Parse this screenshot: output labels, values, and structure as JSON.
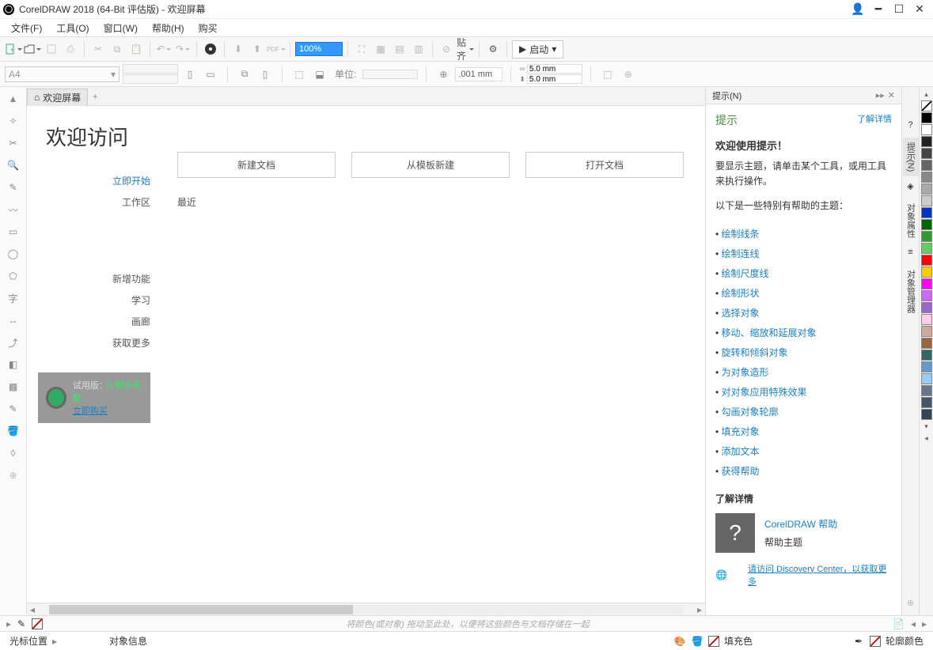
{
  "title": "CorelDRAW 2018 (64-Bit 评估版) - 欢迎屏幕",
  "menus": {
    "file": "文件(F)",
    "tools": "工具(O)",
    "window": "窗口(W)",
    "help": "帮助(H)",
    "buy": "购买"
  },
  "toolbar": {
    "zoom": "100%",
    "snap": "贴齐",
    "launch": "启动"
  },
  "prop": {
    "page": "A4",
    "units": "单位:",
    "nudge": ".001 mm",
    "dup_x": "5.0 mm",
    "dup_y": "5.0 mm"
  },
  "tab": {
    "welcome": "欢迎屏幕"
  },
  "welcome": {
    "title": "欢迎访问",
    "nav": {
      "start": "立即开始",
      "workspace": "工作区",
      "whatsnew": "新增功能",
      "learn": "学习",
      "gallery": "画廊",
      "getmore": "获取更多"
    },
    "actions": {
      "new": "新建文档",
      "template": "从模板新建",
      "open": "打开文档"
    },
    "recent": "最近",
    "trial": {
      "l1a": "试用版：",
      "l1b": "0 剩余天数",
      "l2": "立即购买"
    }
  },
  "hints": {
    "tab": "提示(N)",
    "label": "提示",
    "more": "了解详情",
    "h2": "欢迎使用提示！",
    "p1": "要显示主题，请单击某个工具，或用工具来执行操作。",
    "p2": "以下是一些特别有帮助的主题：",
    "topics": [
      "绘制线条",
      "绘制连线",
      "绘制尺度线",
      "绘制形状",
      "选择对象",
      "移动、缩放和延展对象",
      "旋转和倾斜对象",
      "为对象造形",
      "对对象应用特殊效果",
      "勾画对象轮廓",
      "填充对象",
      "添加文本",
      "获得帮助"
    ],
    "learn": "了解详情",
    "help": "CorelDRAW 帮助",
    "helptopic": "帮助主题",
    "discovery": "请访问 Discovery Center，以获取更多"
  },
  "sidetabs": {
    "hints": "提示(N)",
    "objprop": "对象属性",
    "objmgr": "对象管理器"
  },
  "palette": [
    "#000000",
    "#ffffff",
    "#222222",
    "#444444",
    "#666666",
    "#888888",
    "#aaaaaa",
    "#cccccc",
    "#0033cc",
    "#006600",
    "#339933",
    "#66cc66",
    "#ff0000",
    "#ffcc00",
    "#ff00ff",
    "#cc66ff",
    "#9966cc",
    "#ffccee",
    "#ccaa99",
    "#996644",
    "#336666",
    "#6699cc",
    "#99ccee",
    "#667788",
    "#445566",
    "#334455"
  ],
  "bottom": {
    "hint": "将颜色(或对象) 拖动至此处，以便将这些颜色与文档存储在一起"
  },
  "status": {
    "cursor": "光标位置",
    "objinfo": "对象信息",
    "fill": "填充色",
    "outline": "轮廓颜色"
  }
}
